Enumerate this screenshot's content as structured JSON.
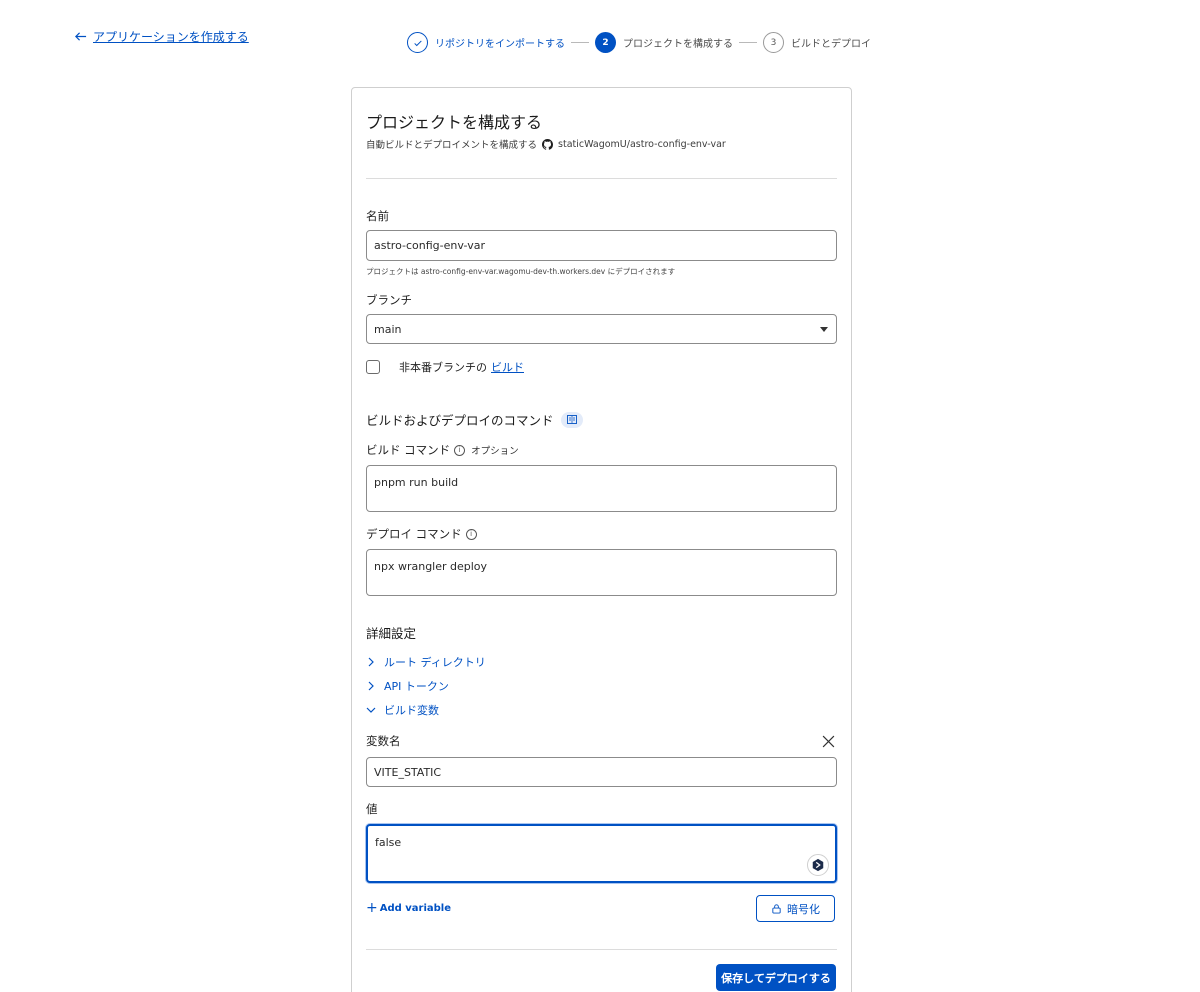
{
  "back_link": {
    "label": "アプリケーションを作成する"
  },
  "stepper": {
    "steps": [
      {
        "number": "",
        "label": "リポジトリをインポートする",
        "state": "done"
      },
      {
        "number": "2",
        "label": "プロジェクトを構成する",
        "state": "active"
      },
      {
        "number": "3",
        "label": "ビルドとデプロイ",
        "state": "todo"
      }
    ]
  },
  "card": {
    "title": "プロジェクトを構成する",
    "subtitle_prefix": "自動ビルドとデプロイメントを構成する",
    "repo": "staticWagomU/astro-config-env-var"
  },
  "name_field": {
    "label": "名前",
    "value": "astro-config-env-var",
    "helper": "プロジェクトは astro-config-env-var.wagomu-dev-th.workers.dev にデプロイされます"
  },
  "branch_field": {
    "label": "ブランチ",
    "value": "main"
  },
  "non_prod_checkbox": {
    "label": "非本番ブランチの",
    "link": "ビルド"
  },
  "build_section": {
    "title": "ビルドおよびデプロイのコマンド"
  },
  "build_command": {
    "label": "ビルド コマンド",
    "optional": "オプション",
    "value": "pnpm run build"
  },
  "deploy_command": {
    "label": "デプロイ コマンド",
    "value": "npx wrangler deploy"
  },
  "advanced": {
    "title": "詳細設定",
    "items": [
      {
        "label": "ルート ディレクトリ",
        "expanded": false
      },
      {
        "label": "API トークン",
        "expanded": false
      },
      {
        "label": "ビルド変数",
        "expanded": true
      }
    ]
  },
  "variable": {
    "name_label": "変数名",
    "name_value": "VITE_STATIC",
    "value_label": "値",
    "value_value": "false"
  },
  "actions": {
    "add_variable": "Add variable",
    "encrypt": "暗号化",
    "save_deploy": "保存してデプロイする"
  },
  "colors": {
    "accent": "#0051c3",
    "border": "#cfcfcf"
  }
}
